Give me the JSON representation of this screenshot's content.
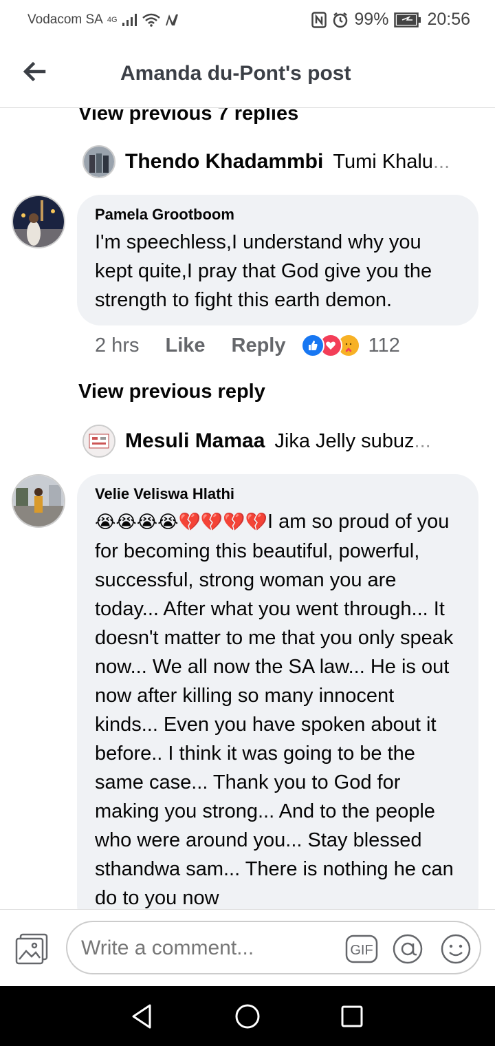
{
  "status_bar": {
    "carrier": "Vodacom SA",
    "network": "4G",
    "battery": "99%",
    "time": "20:56"
  },
  "header": {
    "title": "Amanda du-Pont's post"
  },
  "thread": {
    "view_previous_replies": "View previous 7 replies",
    "reply_preview_1": {
      "name": "Thendo Khadammbi",
      "text": "Tumi Khalu",
      "ellipsis": "..."
    },
    "comment_1": {
      "name": "Pamela Grootboom",
      "text": "I'm speechless,I understand why you kept quite,I pray that God give you the strength to fight this earth demon.",
      "time": "2 hrs",
      "like_label": "Like",
      "reply_label": "Reply",
      "reaction_count": "112",
      "reactions": [
        "like",
        "love",
        "care"
      ]
    },
    "view_previous_reply": "View previous reply",
    "reply_preview_2": {
      "name": "Mesuli Mamaa",
      "text": "Jika Jelly subuz",
      "ellipsis": "..."
    },
    "comment_2": {
      "name": "Velie Veliswa Hlathi",
      "emojis": "😭😭😭😭💔💔💔💔",
      "text": "I am so proud of you for becoming this beautiful, powerful, successful, strong woman you are today... After what you went through... It doesn't matter to me that you only speak now... We all now the SA law... He is out now after killing so many innocent kinds... Even you have spoken about it before.. I think it was going to be the same case... Thank you to God for making you strong... And to the people who were around you... Stay blessed sthandwa sam... There is nothing he can do to you now"
    }
  },
  "composer": {
    "placeholder": "Write a comment...",
    "gif_label": "GIF"
  },
  "colors": {
    "bubble": "#f0f2f5",
    "meta_text": "#65676b",
    "like_blue": "#1877f2",
    "love_red": "#f33e58",
    "care_yellow": "#f7b125"
  }
}
